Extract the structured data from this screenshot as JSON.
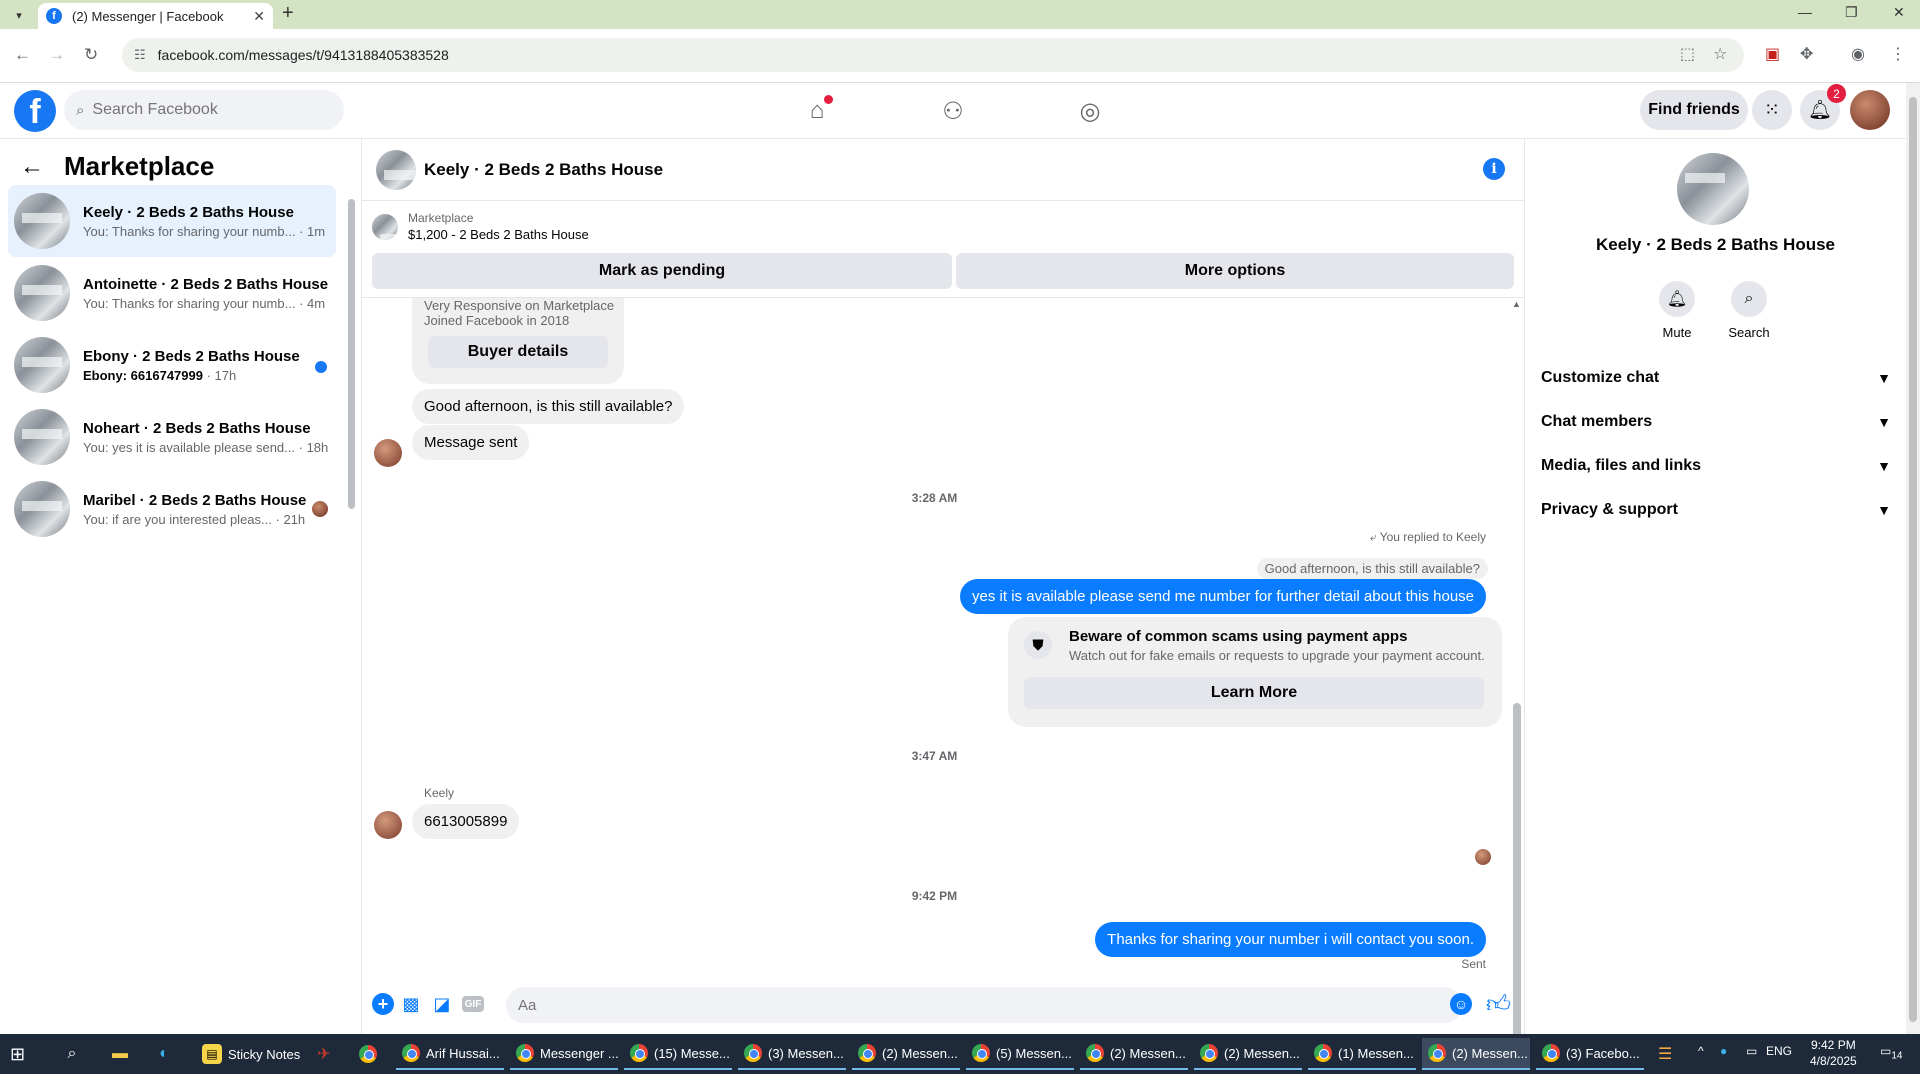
{
  "browser": {
    "tab_title": "(2) Messenger | Facebook",
    "url": "facebook.com/messages/t/9413188405383528"
  },
  "fb": {
    "search_placeholder": "Search Facebook",
    "find_friends": "Find friends",
    "notif_count": "2"
  },
  "sidebar": {
    "title": "Marketplace",
    "conversations": [
      {
        "name": "Keely · 2 Beds 2 Baths House",
        "preview": "You: Thanks for sharing your numb...",
        "time": "· 1m"
      },
      {
        "name": "Antoinette · 2 Beds 2 Baths House",
        "preview": "You: Thanks for sharing your numb...",
        "time": "· 4m"
      },
      {
        "name": "Ebony · 2 Beds 2 Baths House",
        "preview": "Ebony: 6616747999",
        "time": "· 17h"
      },
      {
        "name": "Noheart · 2 Beds 2 Baths House",
        "preview": "You: yes it is available please send...",
        "time": "· 18h"
      },
      {
        "name": "Maribel · 2 Beds 2 Baths House",
        "preview": "You: if are you interested pleas...",
        "time": "· 21h"
      }
    ]
  },
  "chat": {
    "title": "Keely · 2 Beds 2 Baths House",
    "listing_label": "Marketplace",
    "listing_price": "$1,200 - 2 Beds 2 Baths House",
    "mark_pending": "Mark as pending",
    "more_options": "More options",
    "buyer_line1": "Very Responsive on Marketplace",
    "buyer_line2": "Joined Facebook in 2018",
    "buyer_details": "Buyer details",
    "msg1": "Good afternoon, is this still available?",
    "msg2": "Message sent",
    "ts1": "3:28 AM",
    "replied_to": "You replied to Keely",
    "quoted": "Good afternoon, is this still available?",
    "msg3": "yes it is available please send me number for further detail about this house",
    "scam_title": "Beware of common scams using payment apps",
    "scam_sub": "Watch out for fake emails or requests to upgrade your payment account.",
    "learn_more": "Learn More",
    "ts2": "3:47 AM",
    "sender": "Keely",
    "msg4": "6613005899",
    "ts3": "9:42 PM",
    "msg5": "Thanks for sharing your number i will contact you soon.",
    "sent": "Sent",
    "input_placeholder": "Aa"
  },
  "right_panel": {
    "name": "Keely · 2 Beds 2 Baths House",
    "mute": "Mute",
    "search": "Search",
    "rows": [
      "Customize chat",
      "Chat members",
      "Media, files and links",
      "Privacy & support"
    ]
  },
  "taskbar": {
    "apps": [
      "Sticky Notes",
      "Arif Hussai...",
      "Messenger ...",
      "(15) Messe...",
      "(3) Messen...",
      "(2) Messen...",
      "(5) Messen...",
      "(2) Messen...",
      "(2) Messen...",
      "(1) Messen...",
      "(2) Messen...",
      "(3) Facebo..."
    ],
    "lang": "ENG",
    "time": "9:42 PM",
    "date": "4/8/2025",
    "notif": "14"
  }
}
